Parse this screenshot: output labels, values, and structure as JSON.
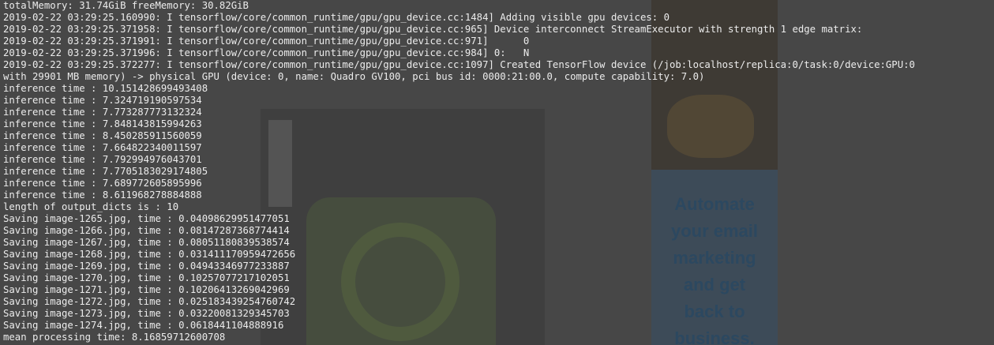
{
  "background": {
    "ad_text": "Automate\nyour email\nmarketing\nand get\nback to\nbusiness."
  },
  "terminal": {
    "lines": [
      "totalMemory: 31.74GiB freeMemory: 30.82GiB",
      "2019-02-22 03:29:25.160990: I tensorflow/core/common_runtime/gpu/gpu_device.cc:1484] Adding visible gpu devices: 0",
      "2019-02-22 03:29:25.371958: I tensorflow/core/common_runtime/gpu/gpu_device.cc:965] Device interconnect StreamExecutor with strength 1 edge matrix:",
      "2019-02-22 03:29:25.371991: I tensorflow/core/common_runtime/gpu/gpu_device.cc:971]      0",
      "2019-02-22 03:29:25.371996: I tensorflow/core/common_runtime/gpu/gpu_device.cc:984] 0:   N",
      "2019-02-22 03:29:25.372277: I tensorflow/core/common_runtime/gpu/gpu_device.cc:1097] Created TensorFlow device (/job:localhost/replica:0/task:0/device:GPU:0",
      "with 29901 MB memory) -> physical GPU (device: 0, name: Quadro GV100, pci bus id: 0000:21:00.0, compute capability: 7.0)",
      "inference time : 10.151428699493408",
      "inference time : 7.324719190597534",
      "inference time : 7.773287773132324",
      "inference time : 7.848143815994263",
      "inference time : 8.450285911560059",
      "inference time : 7.664822340011597",
      "inference time : 7.792994976043701",
      "inference time : 7.7705183029174805",
      "inference time : 7.689772605895996",
      "inference time : 8.611968278884888",
      "length of output_dicts is : 10",
      "Saving image-1265.jpg, time : 0.04098629951477051",
      "Saving image-1266.jpg, time : 0.08147287368774414",
      "Saving image-1267.jpg, time : 0.08051180839538574",
      "Saving image-1268.jpg, time : 0.031411170959472656",
      "Saving image-1269.jpg, time : 0.04943346977233887",
      "Saving image-1270.jpg, time : 0.10257077217102051",
      "Saving image-1271.jpg, time : 0.10206413269042969",
      "Saving image-1272.jpg, time : 0.025183439254760742",
      "Saving image-1273.jpg, time : 0.03220081329345703",
      "Saving image-1274.jpg, time : 0.0618441104888916",
      "mean processing time: 8.16859712600708"
    ]
  }
}
